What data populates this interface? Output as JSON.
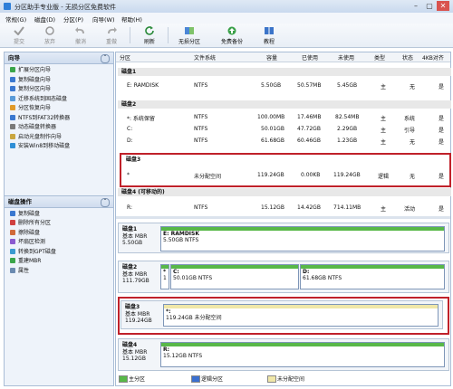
{
  "app": {
    "title": "分区助手专业版 - 无损分区免费软件",
    "win_min": "–",
    "win_max": "▢",
    "win_close": "✕"
  },
  "menu": [
    "常规(G)",
    "磁盘(D)",
    "分区(P)",
    "向导(W)",
    "帮助(H)"
  ],
  "toolbar": {
    "submit": "提交",
    "discard": "放弃",
    "undo": "撤消",
    "redo": "重做",
    "refresh": "刷新",
    "unalloc": "无损分区",
    "backup": "免费备份",
    "tutorial": "教程"
  },
  "wizard": {
    "header": "向导",
    "items": [
      "扩展分区向导",
      "复制磁盘向导",
      "复制分区向导",
      "迁移系统到固态磁盘",
      "分区恢复向导",
      "NTFS到FAT32转换器",
      "动态磁盘转换器",
      "启动光盘制作向导",
      "安装Win8到移动磁盘"
    ]
  },
  "diskops": {
    "header": "磁盘操作",
    "items": [
      "复制磁盘",
      "删除所有分区",
      "擦除磁盘",
      "坏扇区检测",
      "转换到GPT磁盘",
      "重建MBR",
      "属性"
    ]
  },
  "table": {
    "headers": [
      "分区",
      "文件系统",
      "容量",
      "已使用",
      "未使用",
      "类型",
      "状态",
      "4KB对齐"
    ],
    "groups": [
      {
        "name": "磁盘1",
        "rows": [
          [
            "E: RAMDISK",
            "NTFS",
            "5.50GB",
            "50.57MB",
            "5.45GB",
            "主",
            "无",
            "是"
          ]
        ]
      },
      {
        "name": "磁盘2",
        "rows": [
          [
            "*: 系统保留",
            "NTFS",
            "100.00MB",
            "17.46MB",
            "82.54MB",
            "主",
            "系统",
            "是"
          ],
          [
            "C:",
            "NTFS",
            "50.01GB",
            "47.72GB",
            "2.29GB",
            "主",
            "引导",
            "是"
          ],
          [
            "D:",
            "NTFS",
            "61.68GB",
            "60.46GB",
            "1.23GB",
            "主",
            "无",
            "是"
          ]
        ]
      },
      {
        "name": "磁盘3",
        "rows": [
          [
            "*",
            "未分配空间",
            "119.24GB",
            "0.00KB",
            "119.24GB",
            "逻辑",
            "无",
            "是"
          ]
        ]
      },
      {
        "name": "磁盘4 (可移动的)",
        "rows": [
          [
            "R:",
            "NTFS",
            "15.12GB",
            "14.42GB",
            "714.11MB",
            "主",
            "活动",
            "是"
          ]
        ]
      }
    ]
  },
  "maps": [
    {
      "name": "磁盘1",
      "type": "基本 MBR",
      "size": "5.50GB",
      "parts": [
        {
          "t1": "E: RAMDISK",
          "t2": "5.50GB NTFS"
        }
      ]
    },
    {
      "name": "磁盘2",
      "type": "基本 MBR",
      "size": "111.79GB",
      "parts": [
        {
          "t1": "*",
          "t2": "1"
        },
        {
          "t1": "C:",
          "t2": "50.01GB NTFS"
        },
        {
          "t1": "D:",
          "t2": "61.68GB NTFS"
        }
      ]
    },
    {
      "name": "磁盘3",
      "type": "基本 MBR",
      "size": "119.24GB",
      "parts": [
        {
          "t1": "*:",
          "t2": "119.24GB 未分配空间"
        }
      ]
    },
    {
      "name": "磁盘4",
      "type": "基本 MBR",
      "size": "15.12GB",
      "parts": [
        {
          "t1": "R:",
          "t2": "15.12GB NTFS"
        }
      ]
    }
  ],
  "legend": [
    "主分区",
    "逻辑分区",
    "未分配空间"
  ],
  "colors": {
    "primary": "#58b848",
    "logical": "#3a6fd0",
    "unalloc": "#f0e7a8",
    "highlight": "#c0212a"
  }
}
